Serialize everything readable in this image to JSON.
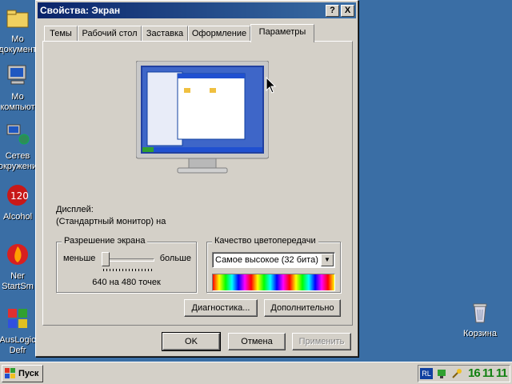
{
  "desktop": {
    "left_icons": [
      "Мо документ",
      "Мо компьют",
      "Сетев окружени",
      "Alcohol",
      "Ner StartSm",
      "AusLogic Defr"
    ],
    "recycle_bin": "Корзина"
  },
  "dialog": {
    "title": "Свойства: Экран",
    "help_button": "?",
    "close_button": "X",
    "tabs": [
      "Темы",
      "Рабочий стол",
      "Заставка",
      "Оформление",
      "Параметры"
    ],
    "active_tab": "Параметры",
    "display_label": "Дисплей:",
    "display_value": "(Стандартный монитор) на",
    "resolution": {
      "title": "Разрешение экрана",
      "less": "меньше",
      "more": "больше",
      "value": "640 на 480 точек",
      "slider_level_fraction": 0.0
    },
    "color": {
      "title": "Качество цветопередачи",
      "selected": "Самое высокое (32 бита)"
    },
    "buttons": {
      "troubleshoot": "Диагностика...",
      "advanced": "Дополнительно",
      "ok": "OK",
      "cancel": "Отмена",
      "apply": "Применить"
    }
  },
  "taskbar": {
    "start": "Пуск",
    "tray_lang": "RL",
    "clock": "16 11 11"
  },
  "colors": {
    "desktop": "#3a6ea5",
    "title_bar": "#0a246a",
    "face": "#d4d0c8"
  }
}
